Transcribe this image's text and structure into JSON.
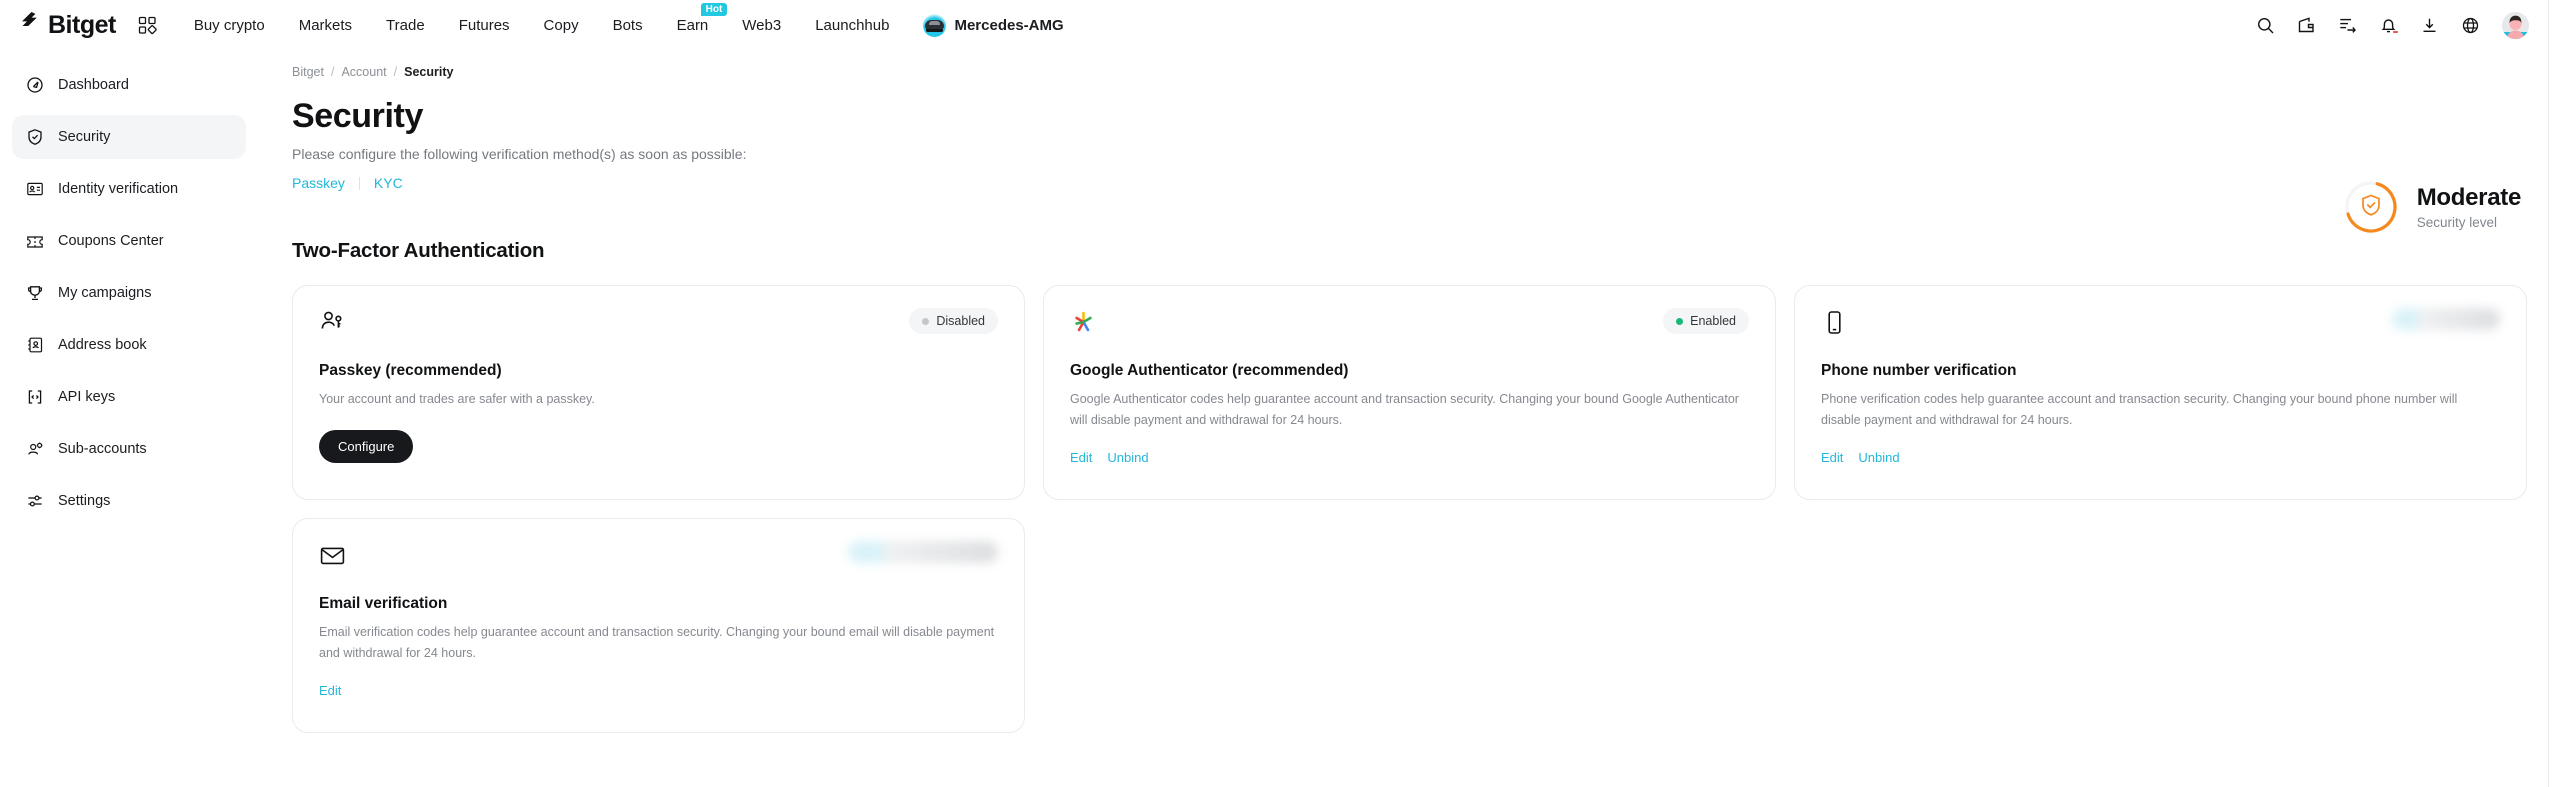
{
  "header": {
    "brand": "Bitget",
    "apps_icon": "grid-apps-icon",
    "nav": [
      {
        "label": "Buy crypto",
        "badge": null
      },
      {
        "label": "Markets",
        "badge": null
      },
      {
        "label": "Trade",
        "badge": null
      },
      {
        "label": "Futures",
        "badge": null
      },
      {
        "label": "Copy",
        "badge": null
      },
      {
        "label": "Bots",
        "badge": null
      },
      {
        "label": "Earn",
        "badge": "Hot"
      },
      {
        "label": "Web3",
        "badge": null
      },
      {
        "label": "Launchhub",
        "badge": null
      }
    ],
    "promo": {
      "label": "Mercedes-AMG",
      "icon": "amg-car-icon"
    },
    "icons": [
      "search-icon",
      "wallet-icon",
      "orders-icon",
      "notification-bell-icon",
      "download-icon",
      "language-globe-icon"
    ],
    "avatar": "user-avatar"
  },
  "sidebar": {
    "items": [
      {
        "label": "Dashboard",
        "icon": "compass-icon",
        "active": false
      },
      {
        "label": "Security",
        "icon": "shield-check-icon",
        "active": true
      },
      {
        "label": "Identity verification",
        "icon": "id-card-icon",
        "active": false
      },
      {
        "label": "Coupons Center",
        "icon": "ticket-icon",
        "active": false
      },
      {
        "label": "My campaigns",
        "icon": "trophy-icon",
        "active": false
      },
      {
        "label": "Address book",
        "icon": "address-book-icon",
        "active": false
      },
      {
        "label": "API keys",
        "icon": "code-brackets-icon",
        "active": false
      },
      {
        "label": "Sub-accounts",
        "icon": "users-gear-icon",
        "active": false
      },
      {
        "label": "Settings",
        "icon": "sliders-icon",
        "active": false
      }
    ]
  },
  "main": {
    "breadcrumb": [
      {
        "label": "Bitget"
      },
      {
        "label": "Account"
      },
      {
        "label": "Security"
      }
    ],
    "breadcrumb_separator": "/",
    "title": "Security",
    "subtitle": "Please configure the following verification method(s) as soon as possible:",
    "quick_links": [
      {
        "label": "Passkey"
      },
      {
        "label": "KYC"
      }
    ],
    "security_level": {
      "value": "Moderate",
      "caption": "Security level",
      "icon": "shield-check-icon",
      "ring_color": "#F5881F",
      "ring_track_color": "#F2F3F5",
      "ring_percent": 66
    },
    "section_title": "Two-Factor Authentication",
    "cards": [
      {
        "id": "passkey",
        "icon": "person-key-icon",
        "status": {
          "label": "Disabled",
          "type": "text",
          "dot_color": "#c3c7cc"
        },
        "title": "Passkey (recommended)",
        "description": "Your account and trades are safer with a passkey.",
        "button": "Configure",
        "links": []
      },
      {
        "id": "google-authenticator",
        "icon": "google-authenticator-icon",
        "status": {
          "label": "Enabled",
          "type": "text",
          "dot_color": "#17b978"
        },
        "title": "Google Authenticator (recommended)",
        "description": "Google Authenticator codes help guarantee account and transaction security. Changing your bound Google Authenticator will disable payment and withdrawal for 24 hours.",
        "button": null,
        "links": [
          "Edit",
          "Unbind"
        ]
      },
      {
        "id": "phone-number",
        "icon": "phone-icon",
        "status": {
          "label": "",
          "type": "blurred",
          "dot_color": ""
        },
        "title": "Phone number verification",
        "description": "Phone verification codes help guarantee account and transaction security. Changing your bound phone number will disable payment and withdrawal for 24 hours.",
        "button": null,
        "links": [
          "Edit",
          "Unbind"
        ]
      },
      {
        "id": "email",
        "icon": "envelope-icon",
        "status": {
          "label": "",
          "type": "blurred-wide",
          "dot_color": ""
        },
        "title": "Email verification",
        "description": "Email verification codes help guarantee account and transaction security. Changing your bound email will disable payment and withdrawal for 24 hours.",
        "button": null,
        "links": [
          "Edit"
        ]
      }
    ]
  },
  "colors": {
    "accent_link": "#22b8d8",
    "brand_black": "#18191c",
    "enabled_green": "#17b978",
    "hot_badge": "#22c8e0",
    "warning_orange": "#F5881F"
  }
}
